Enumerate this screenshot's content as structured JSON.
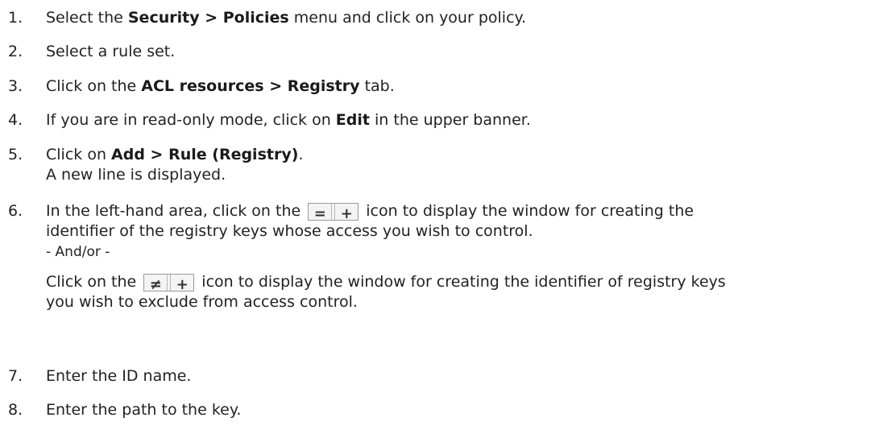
{
  "steps": [
    {
      "num": "1.",
      "pre": "Select the ",
      "b1": "Security > Policies",
      "post": " menu and click on your policy."
    },
    {
      "num": "2.",
      "text": "Select a rule set."
    },
    {
      "num": "3.",
      "pre": "Click on the ",
      "b1": "ACL resources > Registry",
      "post": " tab."
    },
    {
      "num": "4.",
      "pre": "If you are in read-only mode, click on ",
      "b1": "Edit",
      "post": " in the upper banner."
    },
    {
      "num": "5.",
      "pre": "Click on ",
      "b1": "Add > Rule (Registry)",
      "post": ".",
      "line2": "A new line is displayed."
    },
    {
      "num": "6.",
      "pre": "In the left-hand area, click on the ",
      "post": " icon to display the window for creating the",
      "line2": "identifier of the registry keys whose access you wish to control.",
      "andor": "- And/or -",
      "pre2": "Click on the ",
      "post2": " icon to display the window for creating the identifier of registry keys",
      "line4": "you wish to exclude from access control.",
      "icon_include_glyph": "=",
      "icon_exclude_glyph": "≠",
      "icon_add_glyph": "+"
    },
    {
      "num": "7.",
      "text": "Enter the ID name."
    },
    {
      "num": "8.",
      "text": "Enter the path to the key."
    }
  ]
}
